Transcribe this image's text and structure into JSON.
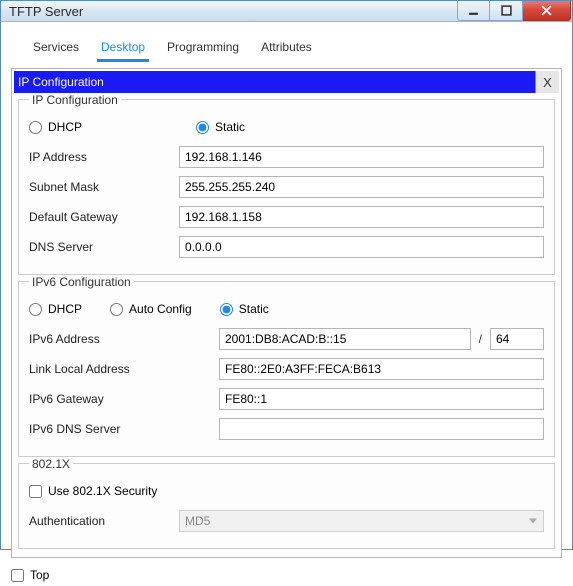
{
  "window": {
    "title": "TFTP Server"
  },
  "tabs": [
    {
      "label": "Services",
      "active": false
    },
    {
      "label": "Desktop",
      "active": true
    },
    {
      "label": "Programming",
      "active": false
    },
    {
      "label": "Attributes",
      "active": false
    }
  ],
  "panel": {
    "title": "IP Configuration",
    "close": "X"
  },
  "ipv4": {
    "legend": "IP Configuration",
    "modes": {
      "dhcp": "DHCP",
      "static": "Static",
      "selected": "static"
    },
    "labels": {
      "ip": "IP Address",
      "mask": "Subnet Mask",
      "gw": "Default Gateway",
      "dns": "DNS Server"
    },
    "values": {
      "ip": "192.168.1.146",
      "mask": "255.255.255.240",
      "gw": "192.168.1.158",
      "dns": "0.0.0.0"
    }
  },
  "ipv6": {
    "legend": "IPv6 Configuration",
    "modes": {
      "dhcp": "DHCP",
      "auto": "Auto Config",
      "static": "Static",
      "selected": "static"
    },
    "labels": {
      "addr": "IPv6 Address",
      "linklocal": "Link Local Address",
      "gw": "IPv6 Gateway",
      "dns": "IPv6 DNS Server"
    },
    "values": {
      "addr": "2001:DB8:ACAD:B::15",
      "prefix": "64",
      "linklocal": "FE80::2E0:A3FF:FECA:B613",
      "gw": "FE80::1",
      "dns": ""
    },
    "slash": "/"
  },
  "dot1x": {
    "legend": "802.1X",
    "use_label": "Use 802.1X Security",
    "use_checked": false,
    "auth_label": "Authentication",
    "auth_value": "MD5"
  },
  "footer": {
    "top_label": "Top",
    "top_checked": false
  }
}
